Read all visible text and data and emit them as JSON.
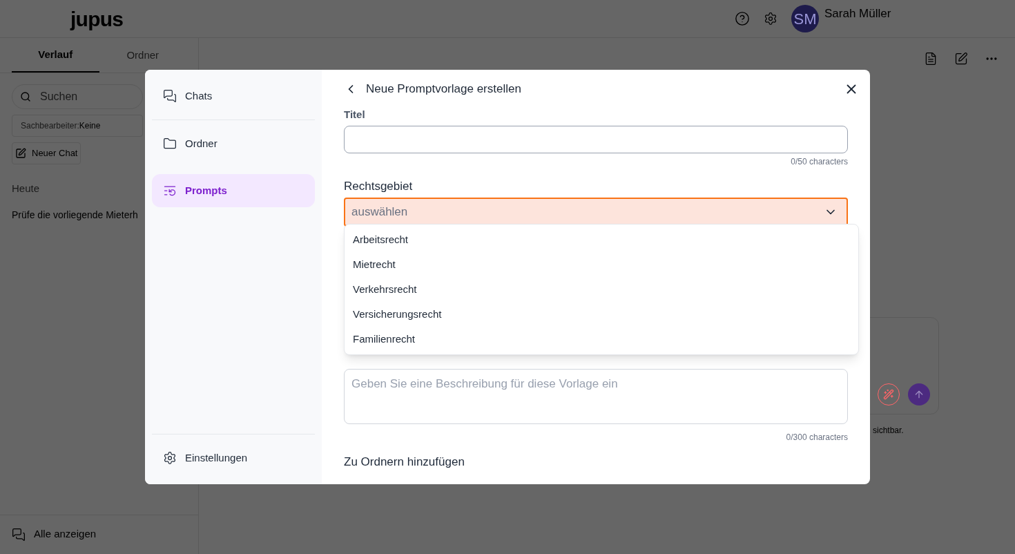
{
  "header": {
    "logo": "jupus",
    "user": {
      "initials": "SM",
      "name": "Sarah Müller"
    }
  },
  "sidebar": {
    "tabs": [
      {
        "label": "Verlauf",
        "selected": true
      },
      {
        "label": "Ordner",
        "selected": false
      }
    ],
    "search": {
      "placeholder": "Suchen"
    },
    "filter": {
      "label": "Sachbearbeiter:",
      "value": "Keine"
    },
    "new_chat": "Neuer Chat",
    "group": "Heute",
    "chats": [
      "Prüfe die vorliegende Mieterh"
    ],
    "show_all": "Alle anzeigen"
  },
  "main": {
    "footer_note": "sichtbar."
  },
  "dialog": {
    "nav": [
      {
        "label": "Chats",
        "selected": false
      },
      {
        "label": "Ordner",
        "selected": false
      },
      {
        "label": "Prompts",
        "selected": true
      }
    ],
    "settings": "Einstellungen",
    "title": "Neue Promptvorlage erstellen",
    "title_field": {
      "label": "Titel",
      "counter": "0/50 characters"
    },
    "area_field": {
      "label": "Rechtsgebiet",
      "placeholder": "auswählen",
      "expanded": true,
      "options": [
        "Arbeitsrecht",
        "Mietrecht",
        "Verkehrsrecht",
        "Versicherungsrecht",
        "Familienrecht"
      ]
    },
    "description_field": {
      "placeholder": "Geben Sie eine Beschreibung für diese Vorlage ein",
      "counter": "0/300 characters"
    },
    "folders_label": "Zu Ordnern hinzufügen"
  }
}
